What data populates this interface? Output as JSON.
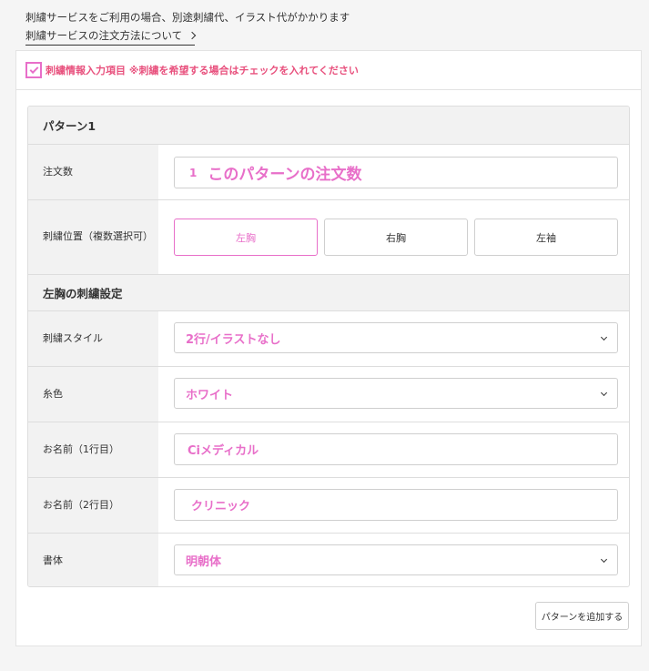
{
  "top": {
    "note": "刺繍サービスをご利用の場合、別途刺繍代、イラスト代がかかります",
    "link": "刺繍サービスの注文方法について"
  },
  "checkbox": {
    "label": "刺繍情報入力項目 ※刺繍を希望する場合はチェックを入れてください",
    "checked": true
  },
  "pattern": {
    "title": "パターン1",
    "quantity": {
      "label": "注文数",
      "number": "1",
      "placeholder": "このパターンの注文数"
    },
    "position": {
      "label": "刺繍位置（複数選択可）",
      "options": [
        "左胸",
        "右胸",
        "左袖"
      ],
      "selected": "左胸"
    }
  },
  "settings": {
    "title": "左胸の刺繍設定",
    "style": {
      "label": "刺繍スタイル",
      "value": "2行/イラストなし"
    },
    "thread": {
      "label": "糸色",
      "value": "ホワイト"
    },
    "name1": {
      "label": "お名前（1行目）",
      "value": "Ciメディカル"
    },
    "name2": {
      "label": "お名前（2行目）",
      "value": "クリニック"
    },
    "font": {
      "label": "書体",
      "value": "明朝体"
    }
  },
  "add_button": "パターンを追加する",
  "colors": {
    "accent": "#e86fc9",
    "check_label": "#e8507d",
    "label_bg": "#f2f2f2"
  }
}
